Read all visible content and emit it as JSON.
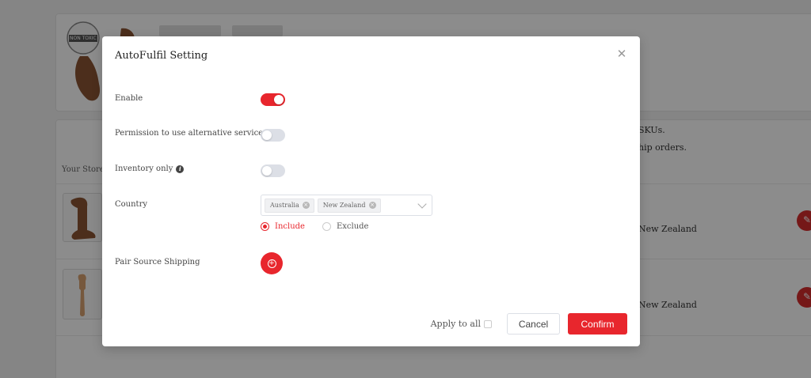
{
  "background": {
    "top_card": {
      "badge_text": "NON TOXIC"
    },
    "list_card": {
      "note_line1": "SKUs.",
      "note_line2": "hip orders.",
      "column_header": "Your Store I",
      "rows": [
        {
          "country_text": "New Zealand"
        },
        {
          "country_text": "New Zealand"
        }
      ]
    }
  },
  "modal": {
    "title": "AutoFulfil Setting",
    "close_icon": "close-icon",
    "enable": {
      "label": "Enable",
      "value": true
    },
    "alt_service": {
      "label": "Permission to use alternative service",
      "value": false
    },
    "inventory_only": {
      "label": "Inventory only",
      "value": false
    },
    "country": {
      "label": "Country",
      "selected": [
        "Australia",
        "New Zealand"
      ],
      "mode_options": [
        "Include",
        "Exclude"
      ],
      "mode_selected": "Include"
    },
    "pair_source_shipping": {
      "label": "Pair Source Shipping"
    },
    "footer": {
      "apply_all_label": "Apply to all",
      "apply_all_checked": false,
      "cancel_label": "Cancel",
      "confirm_label": "Confirm"
    }
  },
  "colors": {
    "accent": "#e8262d",
    "toggle_off": "#dcdfe6",
    "overlay": "rgba(0,0,0,0.45)"
  }
}
